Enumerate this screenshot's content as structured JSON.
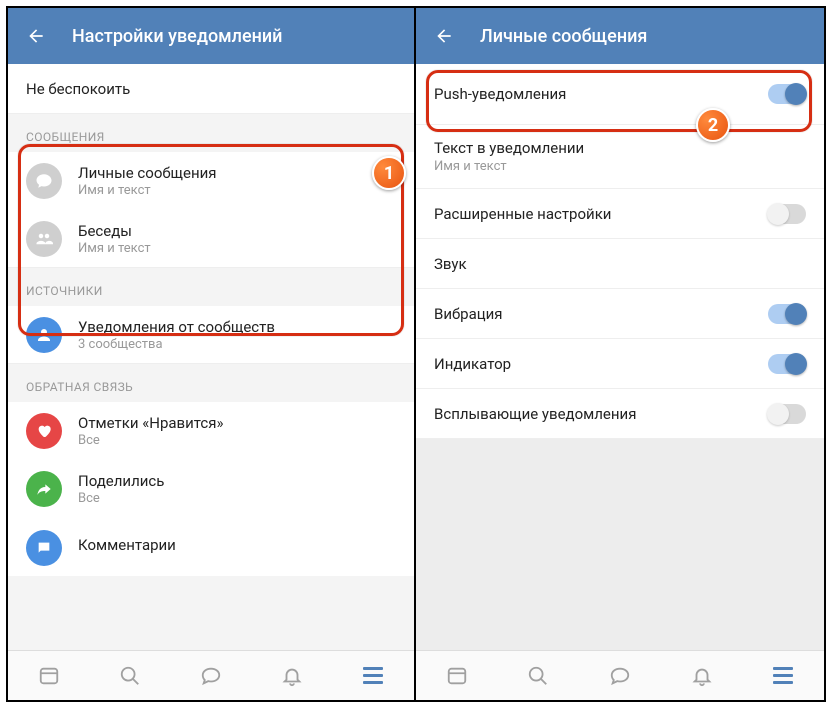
{
  "left": {
    "title": "Настройки уведомлений",
    "dnd": "Не беспокоить",
    "section_messages": "СООБЩЕНИЯ",
    "personal": {
      "label": "Личные сообщения",
      "sub": "Имя и текст"
    },
    "chats": {
      "label": "Беседы",
      "sub": "Имя и текст"
    },
    "section_sources": "ИСТОЧНИКИ",
    "communities": {
      "label": "Уведомления от сообществ",
      "sub": "3 сообщества"
    },
    "section_feedback": "ОБРАТНАЯ СВЯЗЬ",
    "likes": {
      "label": "Отметки «Нравится»",
      "sub": "Все"
    },
    "shares": {
      "label": "Поделились",
      "sub": "Все"
    },
    "comments": {
      "label": "Комментарии"
    }
  },
  "right": {
    "title": "Личные сообщения",
    "push": "Push-уведомления",
    "text_in_notif": {
      "label": "Текст в уведомлении",
      "sub": "Имя и текст"
    },
    "advanced": "Расширенные настройки",
    "sound": "Звук",
    "vibration": "Вибрация",
    "indicator": "Индикатор",
    "popup": "Всплывающие уведомления"
  },
  "badges": {
    "one": "1",
    "two": "2"
  }
}
